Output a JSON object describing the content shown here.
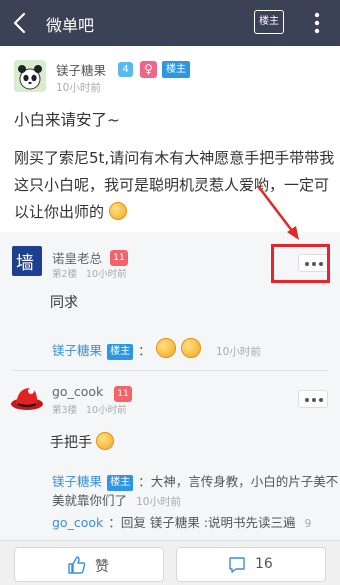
{
  "topbar": {
    "title": "微单吧",
    "louzhu_label": "楼主"
  },
  "post": {
    "author": "镁子糖果",
    "level": "4",
    "gender_symbol": "♀",
    "louzhu_tag": "楼主",
    "time": "10小时前",
    "title": "小白来请安了~",
    "body": "刚买了索尼5t,请问有木有大神愿意手把手带带我这只小白呢，我可是聪明机灵惹人爱哟，一定可以让你出师的"
  },
  "replies": [
    {
      "avatar_text": "墙",
      "name": "诺皇老总",
      "level": "11",
      "floor": "第2楼",
      "time": "10小时前",
      "text": "同求",
      "sub": [
        {
          "name": "镁子糖果",
          "tag": "楼主",
          "text": "：",
          "time": "10小时前"
        }
      ]
    },
    {
      "name": "go_cook",
      "level": "11",
      "floor": "第3楼",
      "time": "10小时前",
      "text": "手把手",
      "sub": [
        {
          "name": "镁子糖果",
          "tag": "楼主",
          "text": "：大神，言传身教，小白的片子美不美就靠你们了",
          "time": "10小时前"
        },
        {
          "name": "go_cook",
          "text": "：回复 镁子糖果 :说明书先读三遍",
          "time": "9"
        }
      ]
    }
  ],
  "bottombar": {
    "like_label": "赞",
    "comment_count": "16"
  },
  "colors": {
    "topbar": "#3c4255",
    "accent_blue": "#2d97e6",
    "highlight_red": "#e3262b",
    "level_red": "#f2646a"
  }
}
